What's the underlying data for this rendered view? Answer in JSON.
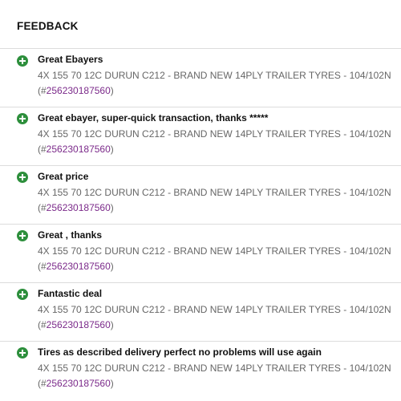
{
  "header": {
    "title": "FEEDBACK"
  },
  "colors": {
    "positive_icon": "#2d8f3c",
    "link": "#7b2a8a",
    "comment_text": "#111111",
    "secondary_text": "#666666",
    "divider": "#dcdcdc"
  },
  "icons": {
    "rating": "positive-plus-circle-icon"
  },
  "feedback": [
    {
      "comment": "Great Ebayers",
      "item_title": "4X 155 70 12C DURUN C212 - BRAND NEW 14PLY TRAILER TYRES - 104/102N",
      "item_prefix": "(#",
      "item_number": "256230187560",
      "item_suffix": ")"
    },
    {
      "comment": "Great ebayer, super-quick transaction, thanks *****",
      "item_title": "4X 155 70 12C DURUN C212 - BRAND NEW 14PLY TRAILER TYRES - 104/102N",
      "item_prefix": "(#",
      "item_number": "256230187560",
      "item_suffix": ")"
    },
    {
      "comment": "Great price",
      "item_title": "4X 155 70 12C DURUN C212 - BRAND NEW 14PLY TRAILER TYRES - 104/102N",
      "item_prefix": "(#",
      "item_number": "256230187560",
      "item_suffix": ")"
    },
    {
      "comment": "Great , thanks",
      "item_title": "4X 155 70 12C DURUN C212 - BRAND NEW 14PLY TRAILER TYRES - 104/102N",
      "item_prefix": "(#",
      "item_number": "256230187560",
      "item_suffix": ")"
    },
    {
      "comment": "Fantastic deal",
      "item_title": "4X 155 70 12C DURUN C212 - BRAND NEW 14PLY TRAILER TYRES - 104/102N",
      "item_prefix": "(#",
      "item_number": "256230187560",
      "item_suffix": ")"
    },
    {
      "comment": "Tires as described delivery perfect no problems will use again",
      "item_title": "4X 155 70 12C DURUN C212 - BRAND NEW 14PLY TRAILER TYRES - 104/102N",
      "item_prefix": "(#",
      "item_number": "256230187560",
      "item_suffix": ")"
    }
  ]
}
